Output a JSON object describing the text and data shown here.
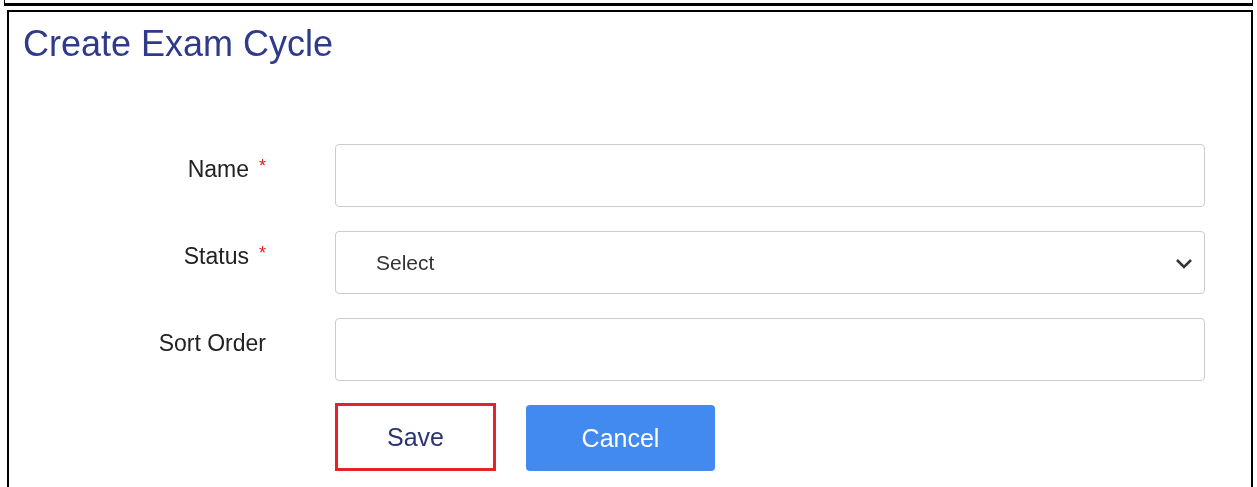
{
  "title": "Create Exam Cycle",
  "fields": [
    {
      "label": "Name",
      "required_mark": "*",
      "kind": "text"
    },
    {
      "label": "Status",
      "required_mark": "*",
      "kind": "select",
      "value": "Select"
    },
    {
      "label": "Sort Order",
      "kind": "text"
    }
  ],
  "buttons": [
    {
      "label": "Save",
      "kind": "outline",
      "highlighted": true
    },
    {
      "label": "Cancel",
      "kind": "primary",
      "highlighted": false
    }
  ]
}
